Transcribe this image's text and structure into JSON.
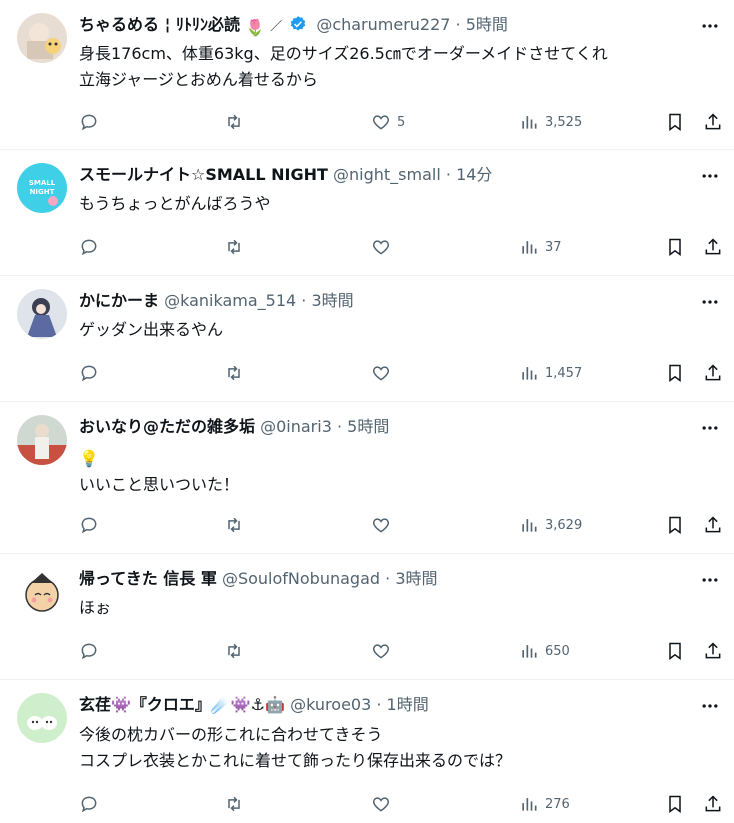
{
  "tweets": [
    {
      "name": "ちゃるめる ¦ ﾘﾄﾘﾝ必読",
      "handle": "@charumeru227",
      "time": "5時間",
      "verified": true,
      "lines": [
        "身長176cm、体重63kg、足のサイズ26.5㎝でオーダーメイドさせてくれ",
        "立海ジャージとおめん着せるから"
      ],
      "likes": "5",
      "views": "3,525",
      "avatar": "avatar-photo-1"
    },
    {
      "name": "スモールナイト☆SMALL NIGHT",
      "handle": "@night_small",
      "time": "14分",
      "verified": false,
      "lines": [
        "もうちょっとがんばろうや"
      ],
      "likes": "",
      "views": "37",
      "avatar_text": "SMALL NIGHT"
    },
    {
      "name": "かにかーま",
      "handle": "@kanikama_514",
      "time": "3時間",
      "verified": false,
      "lines": [
        "ゲッダン出来るやん"
      ],
      "likes": "",
      "views": "1,457"
    },
    {
      "name": "おいなり@ただの雑多垢",
      "handle": "@0inari3",
      "time": "5時間",
      "verified": false,
      "lines": [
        "💡",
        "いいこと思いついた！"
      ],
      "likes": "",
      "views": "3,629"
    },
    {
      "name": "帰ってきた 信長 軍",
      "handle": "@SoulofNobunagad",
      "time": "3時間",
      "verified": false,
      "lines": [
        "ほぉ"
      ],
      "likes": "",
      "views": "650"
    },
    {
      "name": "玄荏👾『クロエ』☄️👾⚓🤖",
      "handle": "@kuroe03",
      "time": "1時間",
      "verified": false,
      "lines": [
        "今後の枕カバーの形これに合わせてきそう",
        "コスプレ衣装とかこれに着せて飾ったり保存出来るのでは？"
      ],
      "likes": "",
      "views": "276"
    }
  ],
  "colors": {
    "text": "#0f1419",
    "muted": "#536471",
    "verified": "#1d9bf0",
    "divider": "#eff3f4"
  },
  "icons": [
    "reply-icon",
    "retweet-icon",
    "like-icon",
    "views-icon",
    "bookmark-icon",
    "share-icon",
    "more-icon",
    "verified-icon"
  ]
}
